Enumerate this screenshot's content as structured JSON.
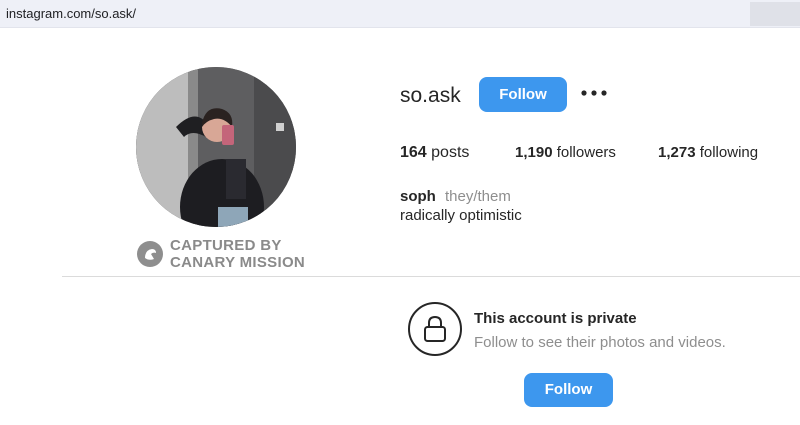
{
  "browser": {
    "url": "instagram.com/so.ask/"
  },
  "profile": {
    "username": "so.ask",
    "follow_label": "Follow",
    "more_icon": "more-horizontal-icon",
    "stats": {
      "posts_count": "164",
      "posts_label": "posts",
      "followers_count": "1,190",
      "followers_label": "followers",
      "following_count": "1,273",
      "following_label": "following"
    },
    "name": "soph",
    "pronouns": "they/them",
    "bio": "radically optimistic"
  },
  "watermark": {
    "line1": "CAPTURED BY",
    "line2": "CANARY MISSION",
    "icon": "canary-bird-icon"
  },
  "private_notice": {
    "icon": "lock-icon",
    "title": "This account is private",
    "subtitle": "Follow to see their photos and videos.",
    "follow_label": "Follow"
  },
  "colors": {
    "accent": "#3d97ee",
    "text": "#262626",
    "muted": "#8e8e8e"
  }
}
